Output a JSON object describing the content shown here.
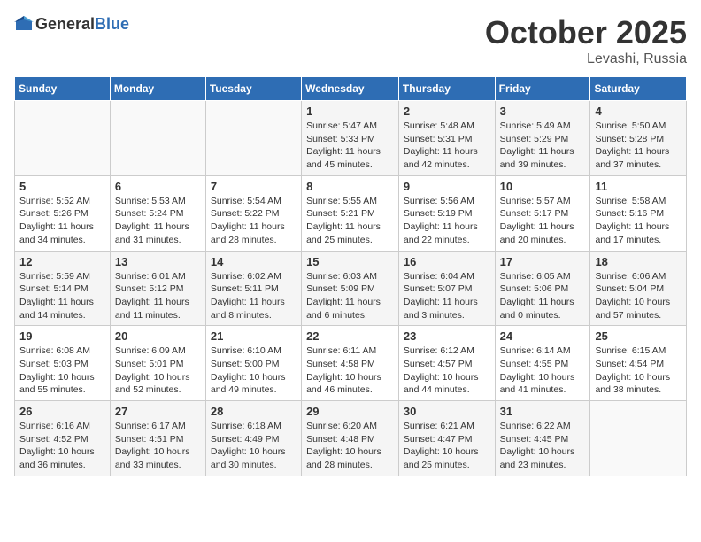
{
  "logo": {
    "text_general": "General",
    "text_blue": "Blue"
  },
  "header": {
    "month": "October 2025",
    "location": "Levashi, Russia"
  },
  "days_of_week": [
    "Sunday",
    "Monday",
    "Tuesday",
    "Wednesday",
    "Thursday",
    "Friday",
    "Saturday"
  ],
  "weeks": [
    [
      {
        "day": "",
        "sunrise": "",
        "sunset": "",
        "daylight": ""
      },
      {
        "day": "",
        "sunrise": "",
        "sunset": "",
        "daylight": ""
      },
      {
        "day": "",
        "sunrise": "",
        "sunset": "",
        "daylight": ""
      },
      {
        "day": "1",
        "sunrise": "Sunrise: 5:47 AM",
        "sunset": "Sunset: 5:33 PM",
        "daylight": "Daylight: 11 hours and 45 minutes."
      },
      {
        "day": "2",
        "sunrise": "Sunrise: 5:48 AM",
        "sunset": "Sunset: 5:31 PM",
        "daylight": "Daylight: 11 hours and 42 minutes."
      },
      {
        "day": "3",
        "sunrise": "Sunrise: 5:49 AM",
        "sunset": "Sunset: 5:29 PM",
        "daylight": "Daylight: 11 hours and 39 minutes."
      },
      {
        "day": "4",
        "sunrise": "Sunrise: 5:50 AM",
        "sunset": "Sunset: 5:28 PM",
        "daylight": "Daylight: 11 hours and 37 minutes."
      }
    ],
    [
      {
        "day": "5",
        "sunrise": "Sunrise: 5:52 AM",
        "sunset": "Sunset: 5:26 PM",
        "daylight": "Daylight: 11 hours and 34 minutes."
      },
      {
        "day": "6",
        "sunrise": "Sunrise: 5:53 AM",
        "sunset": "Sunset: 5:24 PM",
        "daylight": "Daylight: 11 hours and 31 minutes."
      },
      {
        "day": "7",
        "sunrise": "Sunrise: 5:54 AM",
        "sunset": "Sunset: 5:22 PM",
        "daylight": "Daylight: 11 hours and 28 minutes."
      },
      {
        "day": "8",
        "sunrise": "Sunrise: 5:55 AM",
        "sunset": "Sunset: 5:21 PM",
        "daylight": "Daylight: 11 hours and 25 minutes."
      },
      {
        "day": "9",
        "sunrise": "Sunrise: 5:56 AM",
        "sunset": "Sunset: 5:19 PM",
        "daylight": "Daylight: 11 hours and 22 minutes."
      },
      {
        "day": "10",
        "sunrise": "Sunrise: 5:57 AM",
        "sunset": "Sunset: 5:17 PM",
        "daylight": "Daylight: 11 hours and 20 minutes."
      },
      {
        "day": "11",
        "sunrise": "Sunrise: 5:58 AM",
        "sunset": "Sunset: 5:16 PM",
        "daylight": "Daylight: 11 hours and 17 minutes."
      }
    ],
    [
      {
        "day": "12",
        "sunrise": "Sunrise: 5:59 AM",
        "sunset": "Sunset: 5:14 PM",
        "daylight": "Daylight: 11 hours and 14 minutes."
      },
      {
        "day": "13",
        "sunrise": "Sunrise: 6:01 AM",
        "sunset": "Sunset: 5:12 PM",
        "daylight": "Daylight: 11 hours and 11 minutes."
      },
      {
        "day": "14",
        "sunrise": "Sunrise: 6:02 AM",
        "sunset": "Sunset: 5:11 PM",
        "daylight": "Daylight: 11 hours and 8 minutes."
      },
      {
        "day": "15",
        "sunrise": "Sunrise: 6:03 AM",
        "sunset": "Sunset: 5:09 PM",
        "daylight": "Daylight: 11 hours and 6 minutes."
      },
      {
        "day": "16",
        "sunrise": "Sunrise: 6:04 AM",
        "sunset": "Sunset: 5:07 PM",
        "daylight": "Daylight: 11 hours and 3 minutes."
      },
      {
        "day": "17",
        "sunrise": "Sunrise: 6:05 AM",
        "sunset": "Sunset: 5:06 PM",
        "daylight": "Daylight: 11 hours and 0 minutes."
      },
      {
        "day": "18",
        "sunrise": "Sunrise: 6:06 AM",
        "sunset": "Sunset: 5:04 PM",
        "daylight": "Daylight: 10 hours and 57 minutes."
      }
    ],
    [
      {
        "day": "19",
        "sunrise": "Sunrise: 6:08 AM",
        "sunset": "Sunset: 5:03 PM",
        "daylight": "Daylight: 10 hours and 55 minutes."
      },
      {
        "day": "20",
        "sunrise": "Sunrise: 6:09 AM",
        "sunset": "Sunset: 5:01 PM",
        "daylight": "Daylight: 10 hours and 52 minutes."
      },
      {
        "day": "21",
        "sunrise": "Sunrise: 6:10 AM",
        "sunset": "Sunset: 5:00 PM",
        "daylight": "Daylight: 10 hours and 49 minutes."
      },
      {
        "day": "22",
        "sunrise": "Sunrise: 6:11 AM",
        "sunset": "Sunset: 4:58 PM",
        "daylight": "Daylight: 10 hours and 46 minutes."
      },
      {
        "day": "23",
        "sunrise": "Sunrise: 6:12 AM",
        "sunset": "Sunset: 4:57 PM",
        "daylight": "Daylight: 10 hours and 44 minutes."
      },
      {
        "day": "24",
        "sunrise": "Sunrise: 6:14 AM",
        "sunset": "Sunset: 4:55 PM",
        "daylight": "Daylight: 10 hours and 41 minutes."
      },
      {
        "day": "25",
        "sunrise": "Sunrise: 6:15 AM",
        "sunset": "Sunset: 4:54 PM",
        "daylight": "Daylight: 10 hours and 38 minutes."
      }
    ],
    [
      {
        "day": "26",
        "sunrise": "Sunrise: 6:16 AM",
        "sunset": "Sunset: 4:52 PM",
        "daylight": "Daylight: 10 hours and 36 minutes."
      },
      {
        "day": "27",
        "sunrise": "Sunrise: 6:17 AM",
        "sunset": "Sunset: 4:51 PM",
        "daylight": "Daylight: 10 hours and 33 minutes."
      },
      {
        "day": "28",
        "sunrise": "Sunrise: 6:18 AM",
        "sunset": "Sunset: 4:49 PM",
        "daylight": "Daylight: 10 hours and 30 minutes."
      },
      {
        "day": "29",
        "sunrise": "Sunrise: 6:20 AM",
        "sunset": "Sunset: 4:48 PM",
        "daylight": "Daylight: 10 hours and 28 minutes."
      },
      {
        "day": "30",
        "sunrise": "Sunrise: 6:21 AM",
        "sunset": "Sunset: 4:47 PM",
        "daylight": "Daylight: 10 hours and 25 minutes."
      },
      {
        "day": "31",
        "sunrise": "Sunrise: 6:22 AM",
        "sunset": "Sunset: 4:45 PM",
        "daylight": "Daylight: 10 hours and 23 minutes."
      },
      {
        "day": "",
        "sunrise": "",
        "sunset": "",
        "daylight": ""
      }
    ]
  ]
}
